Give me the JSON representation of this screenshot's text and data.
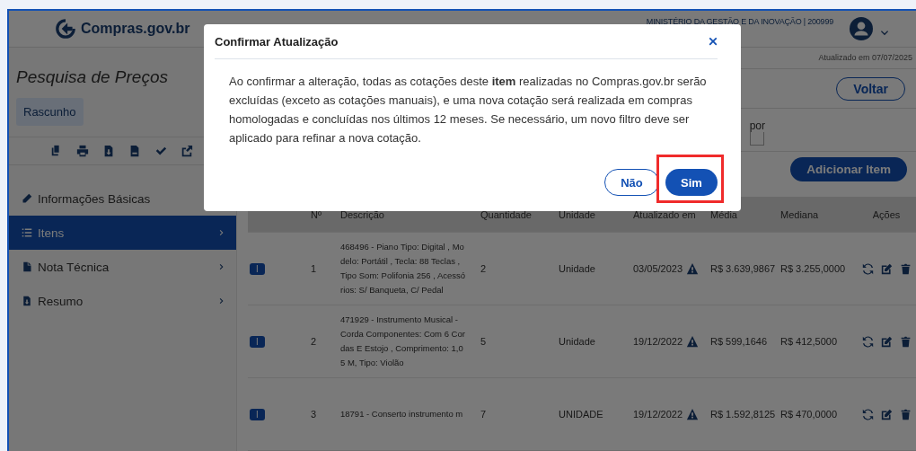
{
  "header": {
    "logo": "Compras.gov.br",
    "organization": "MINISTÉRIO DA GESTÃO E DA INOVAÇÃO | 200999"
  },
  "sidebar": {
    "title": "Pesquisa de Preços",
    "status_badge": "Rascunho",
    "toolbar": [
      {
        "kind": "copy"
      },
      {
        "kind": "print"
      },
      {
        "kind": "download"
      },
      {
        "kind": "csv"
      },
      {
        "kind": "check"
      },
      {
        "kind": "share"
      }
    ],
    "menu": [
      {
        "label": "Informações Básicas",
        "selected": false,
        "expandable": false
      },
      {
        "label": "Itens",
        "selected": true,
        "expandable": true
      },
      {
        "label": "Nota Técnica",
        "selected": false,
        "expandable": true
      },
      {
        "label": "Resumo",
        "selected": false,
        "expandable": true
      }
    ]
  },
  "main": {
    "updated_note": "Atualizado em 07/07/2025",
    "back_button": "Voltar",
    "filter_label": "por",
    "add_button": "Adicionar Item",
    "table": {
      "columns": [
        "Nº",
        "Descrição",
        "Quantidade",
        "Unidade",
        "Atualizado em",
        "Média",
        "Mediana",
        "Ações"
      ],
      "rows": [
        {
          "badge": "I",
          "number": "1",
          "description": "468496 - Piano Tipo: Digital , Mo\ndelo: Portátil , Tecla: 88 Teclas ,\nTipo Som: Polifonia 256 , Acessó\nrios: S/ Banqueta, C/ Pedal",
          "quantity": "2",
          "unit": "Unidade",
          "updated": "03/05/2023",
          "warning": true,
          "average": "R$ 3.639,9867",
          "median": "R$ 3.255,0000"
        },
        {
          "badge": "I",
          "number": "2",
          "description": "471929 - Instrumento Musical -\nCorda Componentes: Com 6 Cor\ndas E Estojo , Comprimento: 1,0\n5 M, Tipo: Violão",
          "quantity": "5",
          "unit": "Unidade",
          "updated": "19/12/2022",
          "warning": true,
          "average": "R$ 599,1646",
          "median": "R$ 412,5000"
        },
        {
          "badge": "I",
          "number": "3",
          "description": "18791 - Conserto instrumento m",
          "quantity": "7",
          "unit": "UNIDADE",
          "updated": "19/12/2022",
          "warning": true,
          "average": "R$ 1.592,8125",
          "median": "R$ 470,0000"
        }
      ]
    }
  },
  "modal": {
    "title": "Confirmar Atualização",
    "message": "Ao confirmar a alteração, todas as cotações deste **item** realizadas no Compras.gov.br serão excluídas (exceto as cotações manuais), e uma nova cotação será realizada em compras homologadas e concluídas nos últimos 12 meses. Se necessário, um novo filtro deve ser aplicado para refinar a nova cotação.",
    "buttons": [
      {
        "label": "Não",
        "kind": "secondary",
        "highlighted": false
      },
      {
        "label": "Sim",
        "kind": "primary",
        "highlighted": true
      }
    ]
  }
}
